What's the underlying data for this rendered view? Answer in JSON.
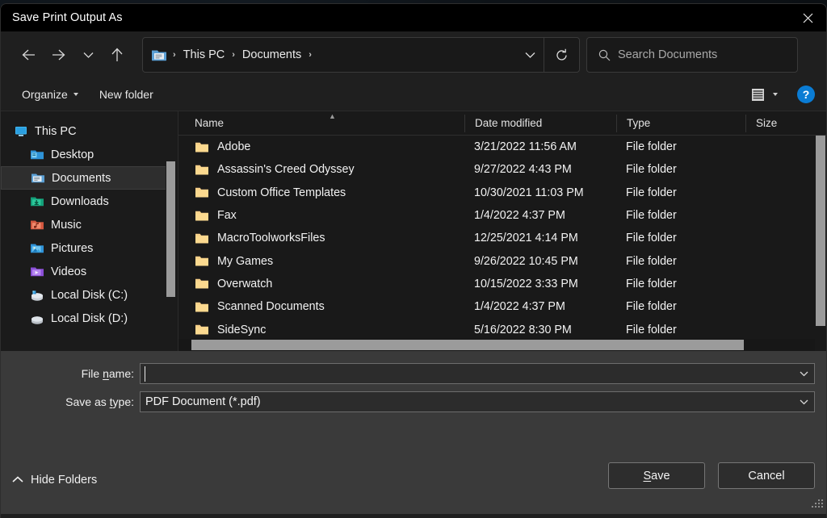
{
  "window": {
    "title": "Save Print Output As",
    "close_icon": "close-icon"
  },
  "nav": {
    "back_icon": "arrow-left-icon",
    "forward_icon": "arrow-right-icon",
    "recent_icon": "chevron-down-icon",
    "up_icon": "arrow-up-icon",
    "refresh_icon": "refresh-icon",
    "address_dropdown_icon": "chevron-down-icon",
    "breadcrumb_icon": "documents-folder-icon",
    "breadcrumb": [
      {
        "label": "This PC"
      },
      {
        "label": "Documents"
      }
    ],
    "breadcrumb_separator": "›"
  },
  "search": {
    "icon": "search-icon",
    "placeholder": "Search Documents",
    "value": ""
  },
  "commandbar": {
    "organize_label": "Organize",
    "organize_caret_icon": "caret-down-icon",
    "new_folder_label": "New folder",
    "view_icon": "list-view-icon",
    "view_caret_icon": "caret-down-icon",
    "help_label": "?",
    "help_icon": "help-icon",
    "help_color": "#0a7cd4"
  },
  "sidebar": {
    "items": [
      {
        "label": "This PC",
        "icon": "this-pc-icon",
        "depth": 0,
        "selected": false
      },
      {
        "label": "Desktop",
        "icon": "desktop-icon",
        "depth": 1,
        "selected": false
      },
      {
        "label": "Documents",
        "icon": "documents-icon",
        "depth": 1,
        "selected": true
      },
      {
        "label": "Downloads",
        "icon": "downloads-icon",
        "depth": 1,
        "selected": false
      },
      {
        "label": "Music",
        "icon": "music-icon",
        "depth": 1,
        "selected": false
      },
      {
        "label": "Pictures",
        "icon": "pictures-icon",
        "depth": 1,
        "selected": false
      },
      {
        "label": "Videos",
        "icon": "videos-icon",
        "depth": 1,
        "selected": false
      },
      {
        "label": "Local Disk (C:)",
        "icon": "local-disk-c-icon",
        "depth": 1,
        "selected": false
      },
      {
        "label": "Local Disk (D:)",
        "icon": "local-disk-d-icon",
        "depth": 1,
        "selected": false
      }
    ]
  },
  "filelist": {
    "columns": [
      "Name",
      "Date modified",
      "Type",
      "Size"
    ],
    "sort_column": "Name",
    "sort_indicator_icon": "sort-ascending-icon",
    "rows": [
      {
        "name": "Adobe",
        "date": "3/21/2022 11:56 AM",
        "type": "File folder",
        "size": "",
        "icon": "folder-icon"
      },
      {
        "name": "Assassin's Creed Odyssey",
        "date": "9/27/2022 4:43 PM",
        "type": "File folder",
        "size": "",
        "icon": "folder-icon"
      },
      {
        "name": "Custom Office Templates",
        "date": "10/30/2021 11:03 PM",
        "type": "File folder",
        "size": "",
        "icon": "folder-icon"
      },
      {
        "name": "Fax",
        "date": "1/4/2022 4:37 PM",
        "type": "File folder",
        "size": "",
        "icon": "folder-icon"
      },
      {
        "name": "MacroToolworksFiles",
        "date": "12/25/2021 4:14 PM",
        "type": "File folder",
        "size": "",
        "icon": "folder-icon"
      },
      {
        "name": "My Games",
        "date": "9/26/2022 10:45 PM",
        "type": "File folder",
        "size": "",
        "icon": "folder-icon"
      },
      {
        "name": "Overwatch",
        "date": "10/15/2022 3:33 PM",
        "type": "File folder",
        "size": "",
        "icon": "folder-icon"
      },
      {
        "name": "Scanned Documents",
        "date": "1/4/2022 4:37 PM",
        "type": "File folder",
        "size": "",
        "icon": "folder-icon"
      },
      {
        "name": "SideSync",
        "date": "5/16/2022 8:30 PM",
        "type": "File folder",
        "size": "",
        "icon": "folder-icon"
      }
    ]
  },
  "form": {
    "filename_label_pre": "File ",
    "filename_label_accel": "n",
    "filename_label_post": "ame:",
    "filename_value": "",
    "filetype_label_pre": "Save as ",
    "filetype_label_accel": "t",
    "filetype_label_post": "ype:",
    "filetype_value": "PDF Document (*.pdf)",
    "dropdown_icon": "chevron-down-icon"
  },
  "footer": {
    "hide_folders_label": "Hide Folders",
    "hide_folders_icon": "chevron-up-icon",
    "save_label_accel": "S",
    "save_label_post": "ave",
    "cancel_label": "Cancel",
    "resize_grip_icon": "resize-grip-icon"
  }
}
